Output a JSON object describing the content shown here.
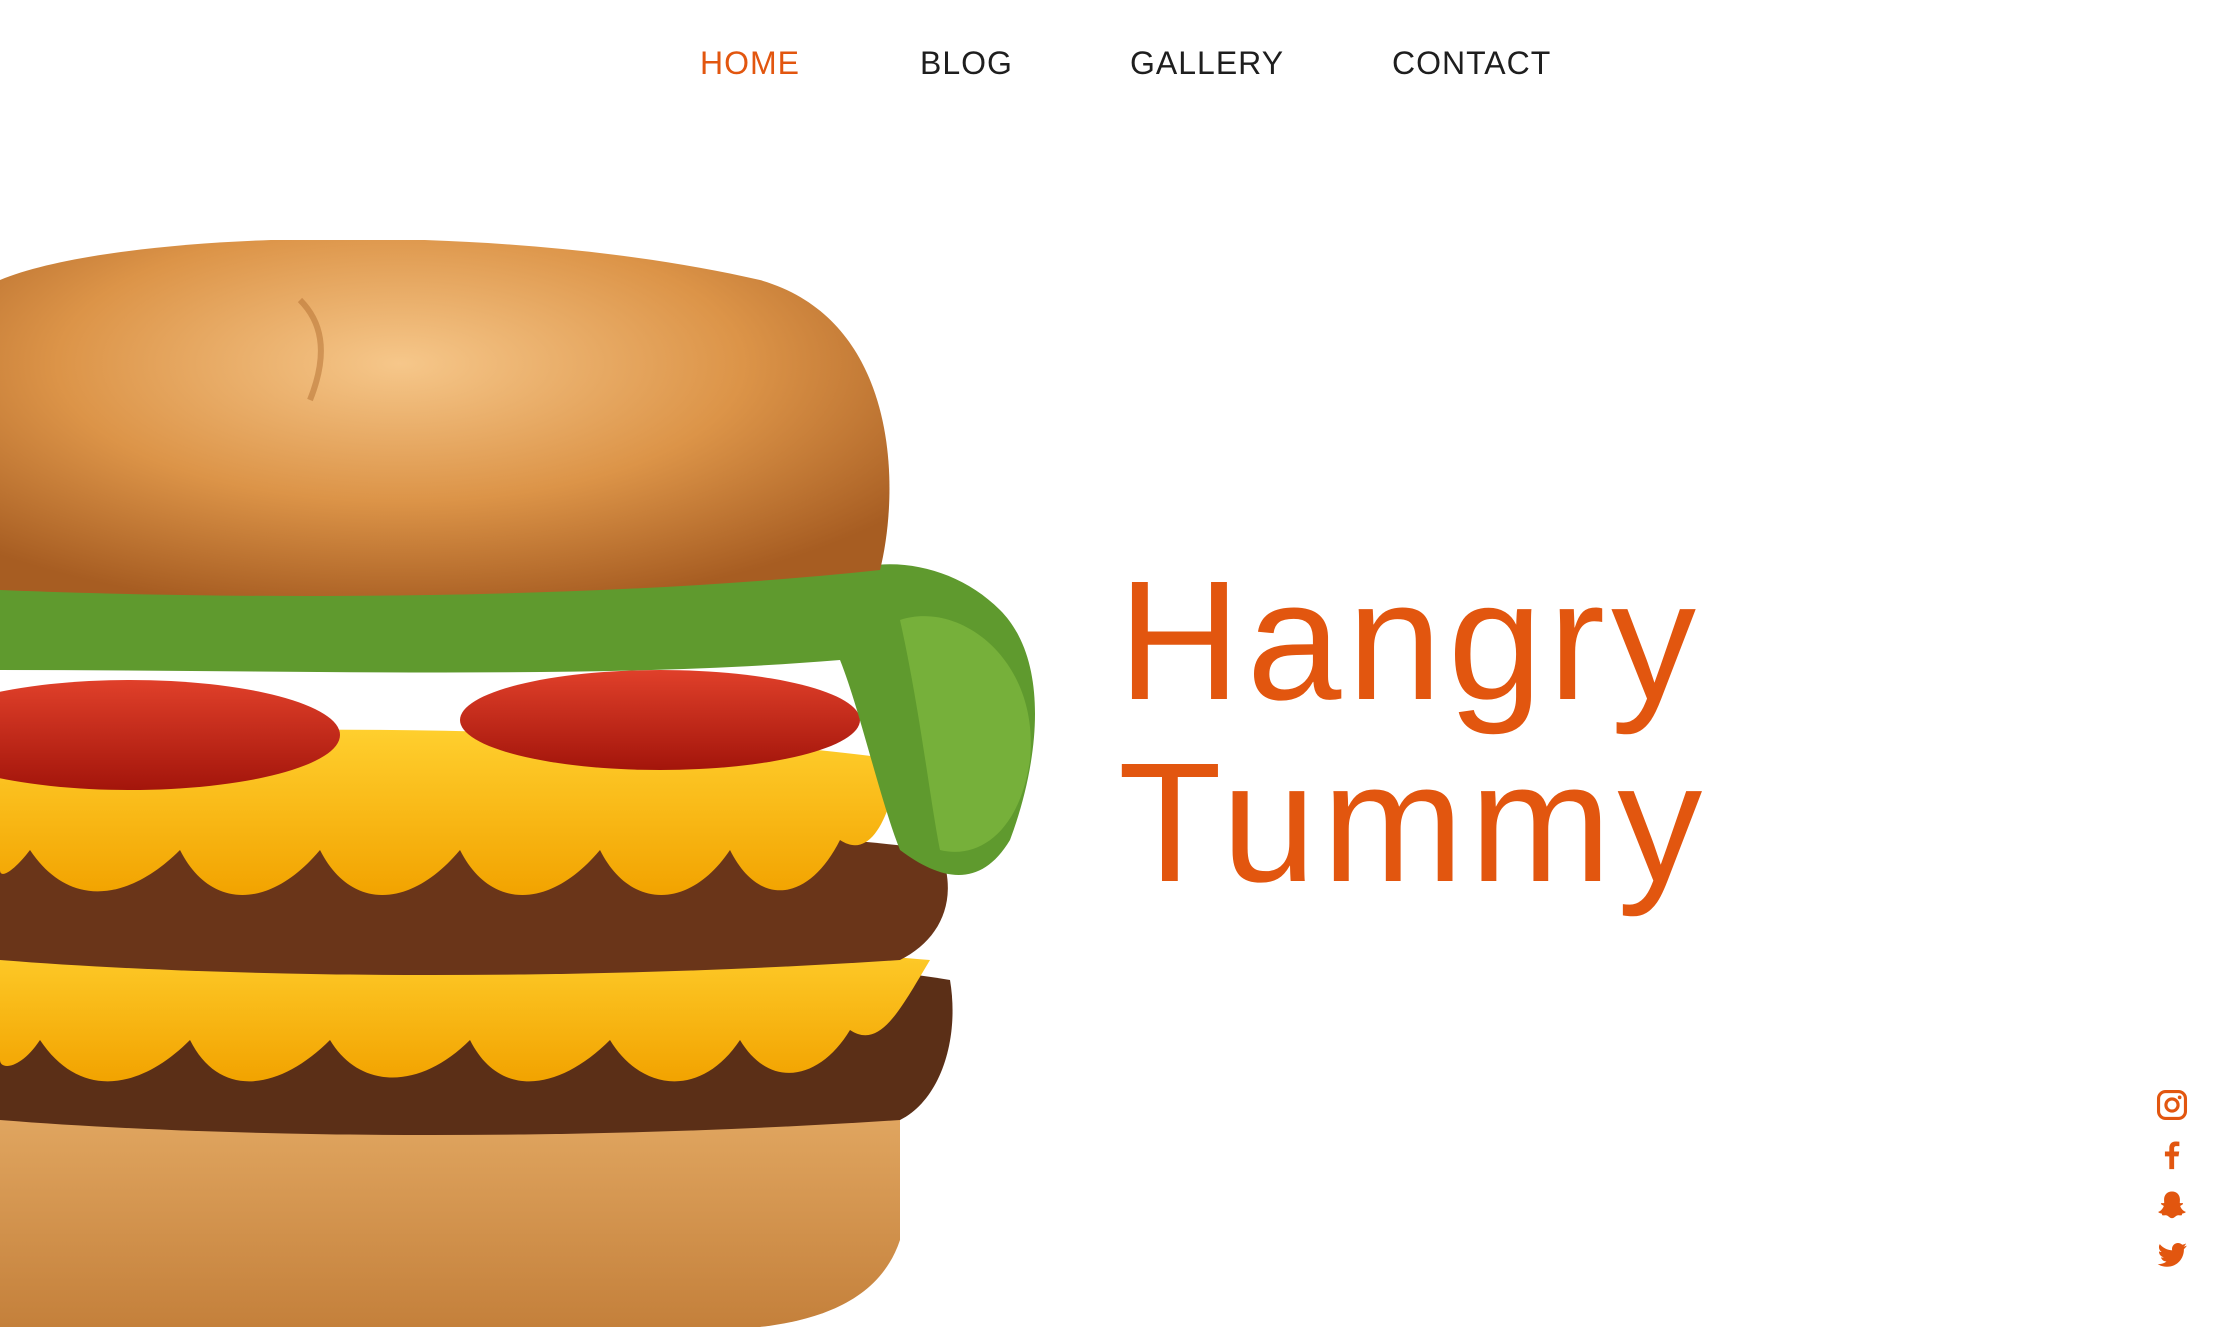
{
  "nav": {
    "items": [
      {
        "label": "HOME",
        "active": true
      },
      {
        "label": "BLOG",
        "active": false
      },
      {
        "label": "GALLERY",
        "active": false
      },
      {
        "label": "CONTACT",
        "active": false
      }
    ]
  },
  "hero": {
    "title_line1": "Hangry",
    "title_line2": "Tummy"
  },
  "hero_image": {
    "subject": "double-cheeseburger"
  },
  "social": {
    "icons": [
      "instagram-icon",
      "facebook-icon",
      "snapchat-icon",
      "twitter-icon"
    ]
  },
  "colors": {
    "accent": "#e2560f",
    "nav_text": "#1e1e1e",
    "background": "#ffffff"
  }
}
